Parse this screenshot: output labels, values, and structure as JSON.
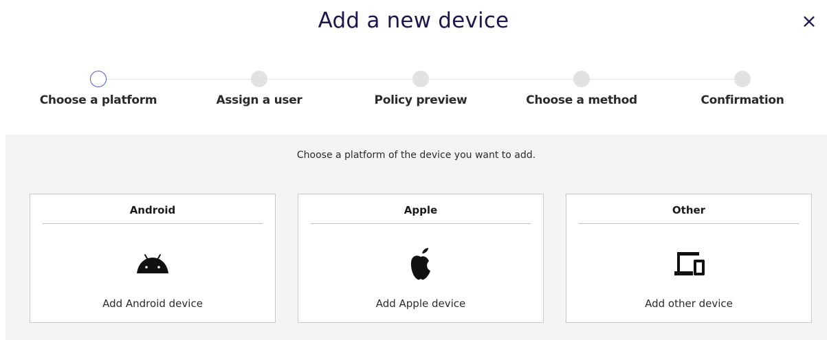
{
  "dialog": {
    "title": "Add a new device",
    "close_symbol": "×"
  },
  "stepper": {
    "steps": [
      {
        "label": "Choose a platform",
        "state": "active"
      },
      {
        "label": "Assign a user",
        "state": "pending"
      },
      {
        "label": "Policy preview",
        "state": "pending"
      },
      {
        "label": "Choose a method",
        "state": "pending"
      },
      {
        "label": "Confirmation",
        "state": "pending"
      }
    ]
  },
  "content": {
    "instruction": "Choose a platform of the device you want to add.",
    "cards": [
      {
        "title": "Android",
        "icon": "android-icon",
        "action": "Add Android device"
      },
      {
        "title": "Apple",
        "icon": "apple-icon",
        "action": "Add Apple device"
      },
      {
        "title": "Other",
        "icon": "devices-icon",
        "action": "Add other device"
      }
    ]
  },
  "colors": {
    "title": "#1c1750",
    "active_step_border": "#4a5bd6",
    "pending_step": "#e2e2e2",
    "content_background": "#f4f4f4",
    "card_border": "#c9c9c9"
  }
}
